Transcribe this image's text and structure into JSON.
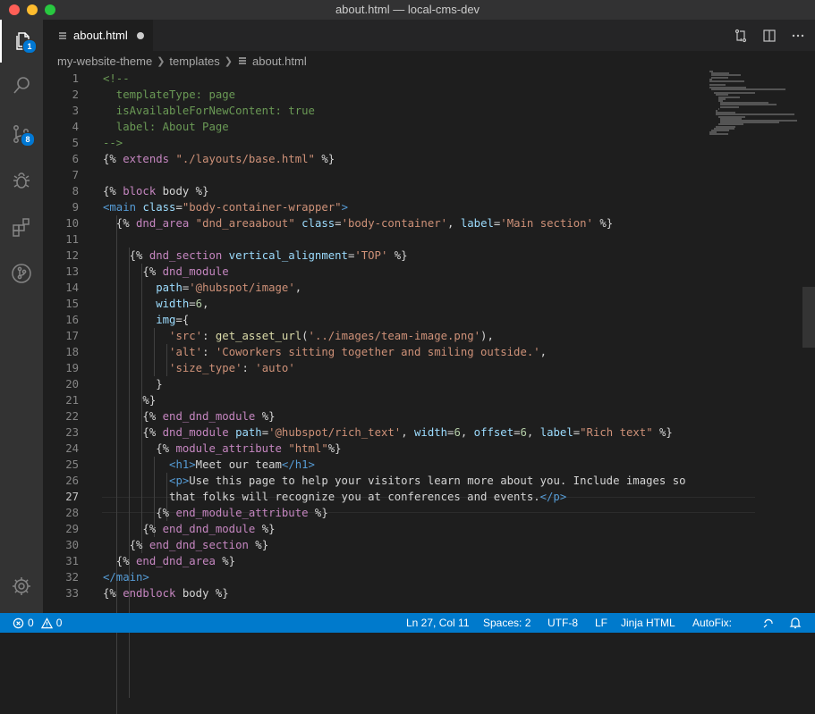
{
  "window": {
    "title": "about.html — local-cms-dev"
  },
  "activity_bar": {
    "explorer_badge": "1",
    "source_control_badge": "8"
  },
  "tab": {
    "label": "about.html"
  },
  "breadcrumb": [
    "my-website-theme",
    "templates",
    "about.html"
  ],
  "code_lines": [
    {
      "n": "1",
      "t": "<!--"
    },
    {
      "n": "2",
      "t": "  templateType: page"
    },
    {
      "n": "3",
      "t": "  isAvailableForNewContent: true"
    },
    {
      "n": "4",
      "t": "  label: About Page"
    },
    {
      "n": "5",
      "t": "-->"
    },
    {
      "n": "6",
      "t": "{% extends \"./layouts/base.html\" %}"
    },
    {
      "n": "7",
      "t": ""
    },
    {
      "n": "8",
      "t": "{% block body %}"
    },
    {
      "n": "9",
      "t": "<main class=\"body-container-wrapper\">"
    },
    {
      "n": "10",
      "t": "  {% dnd_area \"dnd_areaabout\" class='body-container', label='Main section' %}"
    },
    {
      "n": "11",
      "t": ""
    },
    {
      "n": "12",
      "t": "    {% dnd_section vertical_alignment='TOP' %}"
    },
    {
      "n": "13",
      "t": "      {% dnd_module"
    },
    {
      "n": "14",
      "t": "        path='@hubspot/image',"
    },
    {
      "n": "15",
      "t": "        width=6,"
    },
    {
      "n": "16",
      "t": "        img={"
    },
    {
      "n": "17",
      "t": "          'src': get_asset_url('../images/team-image.png'),"
    },
    {
      "n": "18",
      "t": "          'alt': 'Coworkers sitting together and smiling outside.',"
    },
    {
      "n": "19",
      "t": "          'size_type': 'auto'"
    },
    {
      "n": "20",
      "t": "        }"
    },
    {
      "n": "21",
      "t": "      %}"
    },
    {
      "n": "22",
      "t": "      {% end_dnd_module %}"
    },
    {
      "n": "23",
      "t": "      {% dnd_module path='@hubspot/rich_text', width=6, offset=6, label=\"Rich text\" %}"
    },
    {
      "n": "24",
      "t": "        {% module_attribute \"html\"%}"
    },
    {
      "n": "25",
      "t": "          <h1>Meet our team</h1>"
    },
    {
      "n": "26",
      "t": "          <p>Use this page to help your visitors learn more about you. Include images so"
    },
    {
      "n": "27",
      "t": "          that folks will recognize you at conferences and events.</p>"
    },
    {
      "n": "28",
      "t": "        {% end_module_attribute %}"
    },
    {
      "n": "29",
      "t": "      {% end_dnd_module %}"
    },
    {
      "n": "30",
      "t": "    {% end_dnd_section %}"
    },
    {
      "n": "31",
      "t": "  {% end_dnd_area %}"
    },
    {
      "n": "32",
      "t": "</main>"
    },
    {
      "n": "33",
      "t": "{% endblock body %}"
    }
  ],
  "status_bar": {
    "errors": "0",
    "warnings": "0",
    "cursor": "Ln 27, Col 11",
    "spaces": "Spaces: 2",
    "encoding": "UTF-8",
    "eol": "LF",
    "language": "Jinja HTML",
    "autofix": "AutoFix:"
  },
  "colors": {
    "status_bar": "#007acc",
    "activity_bar": "#333333",
    "editor_bg": "#1e1e1e",
    "badge": "#0078d4"
  }
}
